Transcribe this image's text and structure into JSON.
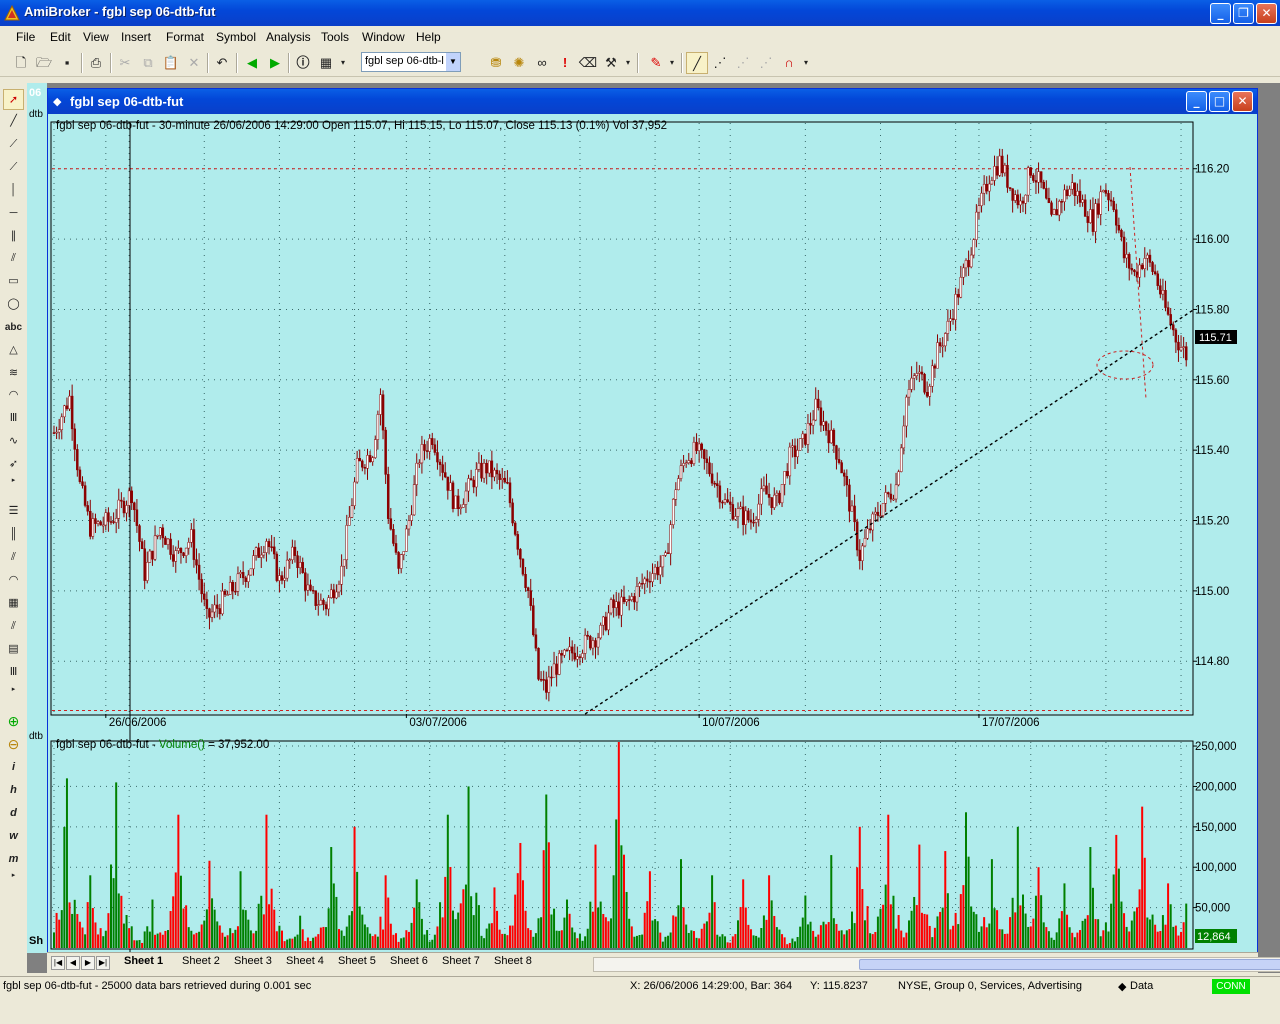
{
  "app": {
    "title": "AmiBroker - fgbl sep 06-dtb-fut"
  },
  "menu": [
    "File",
    "Edit",
    "View",
    "Insert",
    "Format",
    "Symbol",
    "Analysis",
    "Tools",
    "Window",
    "Help"
  ],
  "toolbar": {
    "symbol_value": "fgbl sep 06-dtb-l"
  },
  "left_tools": {
    "text_tool": "abc",
    "interval_labels": [
      "i",
      "h",
      "d",
      "w",
      "m"
    ]
  },
  "background_chart": {
    "label": "06",
    "ticker_stub": "dtb",
    "tab_stub": "Sh"
  },
  "child_window": {
    "title": "fgbl sep 06-dtb-fut"
  },
  "price_pane": {
    "header": "fgbl sep 06-dtb-fut - 30-minute 26/06/2006 14:29:00 Open 115.07, Hi 115.15, Lo 115.07, Close 115.13 (0.1%) Vol 37,952",
    "last_price": "115.71",
    "colors": {
      "background": "#b0ecec",
      "bar": "#8b0000",
      "hline": "#cc2222",
      "trendline": "#000000"
    }
  },
  "volume_pane": {
    "header_prefix": "fgbl sep 06-dtb-fut - ",
    "header_func": "Volume()",
    "header_suffix": " = 37,952.00",
    "last_volume": "12,864",
    "colors": {
      "up": "#008000",
      "down": "#ff0000",
      "last_box": "#008000"
    }
  },
  "chart_data": [
    {
      "type": "candlestick",
      "title": "fgbl sep 06-dtb-fut - 30-minute",
      "y_ticks": [
        "116.20",
        "116.00",
        "115.80",
        "115.60",
        "115.40",
        "115.20",
        "115.00",
        "114.80"
      ],
      "y_range": [
        114.65,
        116.33
      ],
      "x_ticks": [
        "26/06/2006",
        "03/07/2006",
        "10/07/2006",
        "17/07/2006"
      ],
      "close_path": [
        [
          0,
          115.45
        ],
        [
          6,
          115.55
        ],
        [
          10,
          115.3
        ],
        [
          14,
          115.18
        ],
        [
          22,
          115.2
        ],
        [
          30,
          115.28
        ],
        [
          35,
          115.05
        ],
        [
          41,
          115.18
        ],
        [
          47,
          115.1
        ],
        [
          53,
          115.15
        ],
        [
          59,
          114.92
        ],
        [
          65,
          114.97
        ],
        [
          75,
          115.06
        ],
        [
          82,
          115.15
        ],
        [
          87,
          115.03
        ],
        [
          93,
          115.11
        ],
        [
          99,
          114.98
        ],
        [
          105,
          114.96
        ],
        [
          111,
          115.06
        ],
        [
          117,
          115.35
        ],
        [
          123,
          115.4
        ],
        [
          126,
          115.56
        ],
        [
          129,
          115.22
        ],
        [
          133,
          115.05
        ],
        [
          137,
          115.2
        ],
        [
          141,
          115.38
        ],
        [
          146,
          115.44
        ],
        [
          151,
          115.33
        ],
        [
          155,
          115.24
        ],
        [
          159,
          115.28
        ],
        [
          163,
          115.33
        ],
        [
          167,
          115.35
        ],
        [
          171,
          115.32
        ],
        [
          175,
          115.29
        ],
        [
          180,
          115.1
        ],
        [
          183,
          115.0
        ],
        [
          187,
          114.75
        ],
        [
          190,
          114.72
        ],
        [
          193,
          114.78
        ],
        [
          199,
          114.82
        ],
        [
          205,
          114.85
        ],
        [
          211,
          114.88
        ],
        [
          215,
          114.95
        ],
        [
          221,
          114.96
        ],
        [
          225,
          115.0
        ],
        [
          230,
          115.05
        ],
        [
          236,
          115.08
        ],
        [
          240,
          115.3
        ],
        [
          244,
          115.38
        ],
        [
          248,
          115.4
        ],
        [
          254,
          115.33
        ],
        [
          259,
          115.25
        ],
        [
          264,
          115.22
        ],
        [
          269,
          115.2
        ],
        [
          274,
          115.28
        ],
        [
          279,
          115.25
        ],
        [
          284,
          115.38
        ],
        [
          289,
          115.42
        ],
        [
          294,
          115.52
        ],
        [
          299,
          115.45
        ],
        [
          303,
          115.38
        ],
        [
          307,
          115.25
        ],
        [
          311,
          115.1
        ],
        [
          315,
          115.18
        ],
        [
          320,
          115.25
        ],
        [
          325,
          115.3
        ],
        [
          329,
          115.55
        ],
        [
          333,
          115.62
        ],
        [
          337,
          115.58
        ],
        [
          341,
          115.68
        ],
        [
          345,
          115.75
        ],
        [
          349,
          115.85
        ],
        [
          353,
          115.95
        ],
        [
          357,
          116.08
        ],
        [
          361,
          116.18
        ],
        [
          365,
          116.22
        ],
        [
          369,
          116.15
        ],
        [
          373,
          116.1
        ],
        [
          377,
          116.2
        ],
        [
          381,
          116.15
        ],
        [
          385,
          116.05
        ],
        [
          389,
          116.12
        ],
        [
          393,
          116.15
        ],
        [
          397,
          116.1
        ],
        [
          401,
          116.05
        ],
        [
          405,
          116.15
        ],
        [
          409,
          116.1
        ],
        [
          413,
          115.95
        ],
        [
          417,
          115.9
        ],
        [
          421,
          115.95
        ],
        [
          425,
          115.9
        ],
        [
          429,
          115.8
        ],
        [
          433,
          115.72
        ],
        [
          437,
          115.67
        ]
      ],
      "horizontal_lines": [
        116.2,
        114.66
      ],
      "trendline": [
        [
          205,
          114.65
        ],
        [
          440,
          115.8
        ]
      ]
    },
    {
      "type": "bar",
      "title": "Volume()",
      "y_ticks": [
        "250,000",
        "200,000",
        "150,000",
        "100,000",
        "50,000"
      ],
      "y_range": [
        0,
        255000
      ],
      "peaks": [
        [
          5,
          210000
        ],
        [
          14,
          90000
        ],
        [
          24,
          205000
        ],
        [
          38,
          60000
        ],
        [
          48,
          165000
        ],
        [
          60,
          108000
        ],
        [
          72,
          95000
        ],
        [
          82,
          165000
        ],
        [
          95,
          40000
        ],
        [
          107,
          125000
        ],
        [
          116,
          150000
        ],
        [
          128,
          90000
        ],
        [
          140,
          85000
        ],
        [
          152,
          165000
        ],
        [
          160,
          200000
        ],
        [
          170,
          75000
        ],
        [
          180,
          130000
        ],
        [
          190,
          190000
        ],
        [
          198,
          60000
        ],
        [
          209,
          128000
        ],
        [
          218,
          255000
        ],
        [
          230,
          95000
        ],
        [
          242,
          110000
        ],
        [
          254,
          90000
        ],
        [
          266,
          85000
        ],
        [
          276,
          90000
        ],
        [
          290,
          65000
        ],
        [
          300,
          115000
        ],
        [
          311,
          150000
        ],
        [
          322,
          165000
        ],
        [
          334,
          128000
        ],
        [
          344,
          120000
        ],
        [
          352,
          168000
        ],
        [
          362,
          110000
        ],
        [
          372,
          150000
        ],
        [
          380,
          100000
        ],
        [
          390,
          80000
        ],
        [
          400,
          125000
        ],
        [
          410,
          140000
        ],
        [
          420,
          175000
        ],
        [
          430,
          80000
        ],
        [
          437,
          55000
        ]
      ]
    }
  ],
  "sheets": [
    "Sheet 1",
    "Sheet 2",
    "Sheet 3",
    "Sheet 4",
    "Sheet 5",
    "Sheet 6",
    "Sheet 7",
    "Sheet 8"
  ],
  "status": {
    "message": "fgbl sep 06-dtb-fut - 25000 data bars retrieved during 0.001 sec",
    "coords": "X: 26/06/2006 14:29:00, Bar: 364",
    "y": "Y: 115.8237",
    "market": "NYSE, Group 0, Services, Advertising",
    "data": "Data",
    "conn": "CONN"
  }
}
